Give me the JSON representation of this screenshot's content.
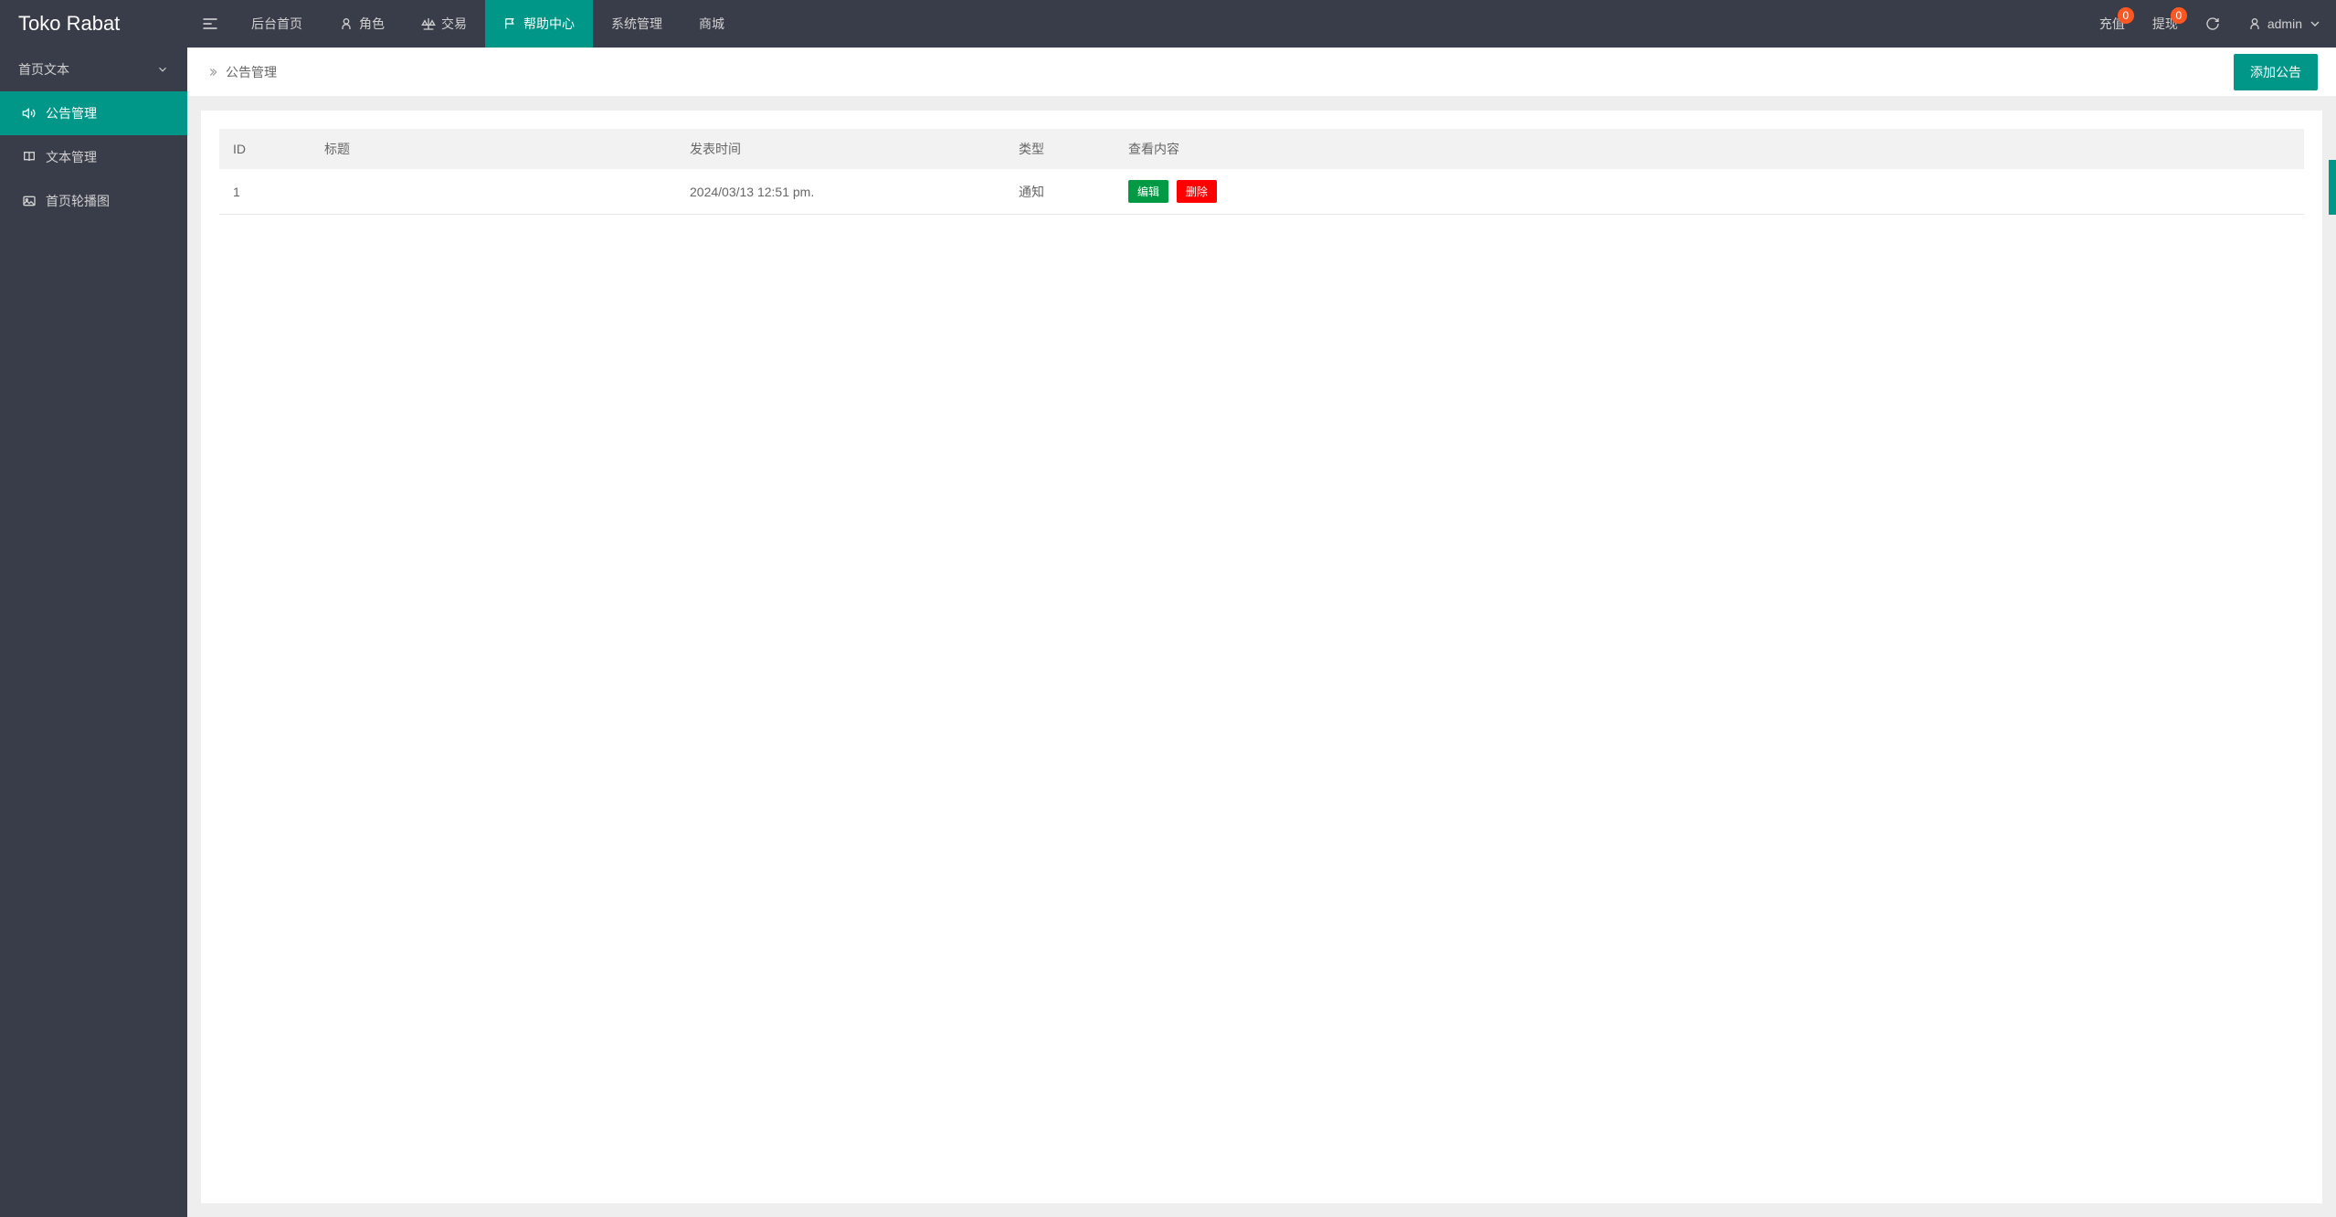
{
  "app_name": "Toko Rabat",
  "top_nav": {
    "items": [
      {
        "label": "后台首页",
        "icon": null
      },
      {
        "label": "角色",
        "icon": "user"
      },
      {
        "label": "交易",
        "icon": "scale"
      },
      {
        "label": "帮助中心",
        "icon": "flag",
        "active": true
      },
      {
        "label": "系统管理",
        "icon": null
      },
      {
        "label": "商城",
        "icon": null
      }
    ]
  },
  "header_right": {
    "recharge": {
      "label": "充值",
      "badge": "0"
    },
    "withdraw": {
      "label": "提现",
      "badge": "0"
    },
    "user": {
      "label": "admin"
    }
  },
  "sidebar": {
    "group_label": "首页文本",
    "items": [
      {
        "label": "公告管理",
        "icon": "speaker",
        "active": true
      },
      {
        "label": "文本管理",
        "icon": "book"
      },
      {
        "label": "首页轮播图",
        "icon": "image"
      }
    ]
  },
  "breadcrumb": {
    "title": "公告管理"
  },
  "actions": {
    "add_label": "添加公告"
  },
  "table": {
    "headers": {
      "id": "ID",
      "title": "标题",
      "publish_time": "发表时间",
      "type": "类型",
      "view_content": "查看内容"
    },
    "rows": [
      {
        "id": "1",
        "title": "",
        "publish_time": "2024/03/13 12:51 pm.",
        "type": "通知",
        "edit_label": "编辑",
        "delete_label": "删除"
      }
    ]
  }
}
